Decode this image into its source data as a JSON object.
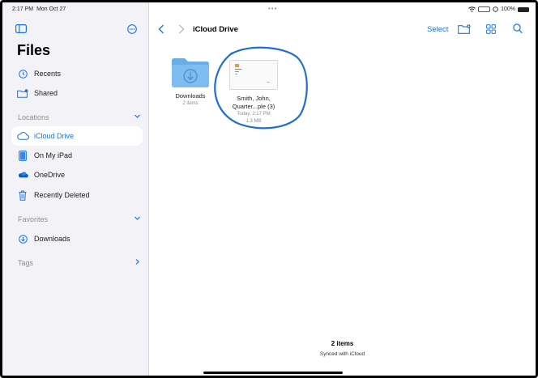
{
  "status_bar": {
    "time": "2:17 PM",
    "date": "Mon Oct 27",
    "battery": "100%"
  },
  "colors": {
    "accent": "#1a73e8",
    "sidebar_bg": "#f2f2f7",
    "folder": "#6aaee9",
    "annotation": "#1e6fd0"
  },
  "sidebar": {
    "title": "Files",
    "top_items": [
      {
        "label": "Recents",
        "icon": "clock-icon"
      },
      {
        "label": "Shared",
        "icon": "shared-folder-icon"
      }
    ],
    "locations_header": "Locations",
    "locations": [
      {
        "label": "iCloud Drive",
        "icon": "cloud-icon",
        "selected": true
      },
      {
        "label": "On My iPad",
        "icon": "ipad-icon"
      },
      {
        "label": "OneDrive",
        "icon": "onedrive-icon"
      },
      {
        "label": "Recently Deleted",
        "icon": "trash-icon"
      }
    ],
    "favorites_header": "Favorites",
    "favorites": [
      {
        "label": "Downloads",
        "icon": "download-circle-icon"
      }
    ],
    "tags_header": "Tags"
  },
  "main": {
    "title": "iCloud Drive",
    "select_label": "Select",
    "items": [
      {
        "name": "Downloads",
        "meta": "2 items",
        "kind": "folder"
      },
      {
        "name_line1": "Smith, John,",
        "name_line2": "Quarter...ple (3)",
        "date": "Today, 2:17 PM",
        "size": "1.3 MB",
        "kind": "document"
      }
    ],
    "footer": {
      "count": "2 items",
      "sync": "Synced with iCloud"
    }
  }
}
